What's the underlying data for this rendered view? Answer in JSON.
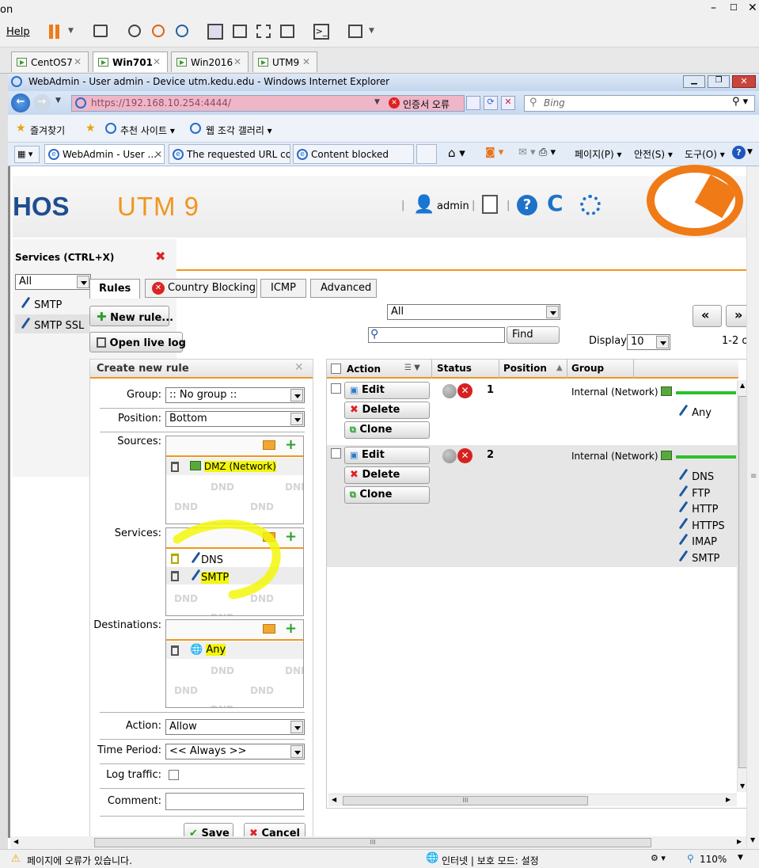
{
  "vm": {
    "title_fragment": "on",
    "menu_help": "Help",
    "tabs": [
      "CentOS7",
      "Win701",
      "Win2016",
      "UTM9"
    ]
  },
  "ie": {
    "title": "WebAdmin - User admin - Device utm.kedu.edu - Windows Internet Explorer",
    "url": "https://192.168.10.254:4444/",
    "cert_error": "인증서 오류",
    "search_placeholder": "Bing",
    "favorites": "즐겨찾기",
    "suggested_sites": "추천 사이트 ▾",
    "web_slice": "웹 조각 갤러리 ▾",
    "tabs": [
      "WebAdmin - User ...",
      "The requested URL co...",
      "Content blocked"
    ],
    "cmd_page": "페이지(P) ▾",
    "cmd_safety": "안전(S) ▾",
    "cmd_tools": "도구(O) ▾",
    "status_text": "페이지에 오류가 있습니다.",
    "zone_text": "인터넷 | 보호 모드: 설정",
    "zoom": "110%"
  },
  "header": {
    "brand_fragment": "HOS",
    "product": "UTM 9",
    "user": "admin"
  },
  "services_panel": {
    "title": "Services (CTRL+X)",
    "filter_value": "All",
    "items": [
      "SMTP",
      "SMTP SSL"
    ]
  },
  "tabs": [
    "Rules",
    "Country Blocking",
    "ICMP",
    "Advanced"
  ],
  "toolbar": {
    "new_rule": "New rule...",
    "open_live_log": "Open live log",
    "filter_value": "All",
    "find": "Find",
    "display_label": "Display:",
    "display_value": "10",
    "range": "1-2 of",
    "prev": "«",
    "next": "»"
  },
  "form": {
    "title": "Create new rule",
    "group_label": "Group:",
    "group_value": ":: No group ::",
    "position_label": "Position:",
    "position_value": "Bottom",
    "sources_label": "Sources:",
    "sources": [
      "DMZ (Network)"
    ],
    "services_label": "Services:",
    "services": [
      "DNS",
      "SMTP"
    ],
    "destinations_label": "Destinations:",
    "destinations": [
      "Any"
    ],
    "action_label": "Action:",
    "action_value": "Allow",
    "time_label": "Time Period:",
    "time_value": "<< Always >>",
    "log_label": "Log traffic:",
    "comment_label": "Comment:",
    "dnd": "DND",
    "save": "Save",
    "cancel": "Cancel"
  },
  "grid": {
    "columns": [
      "Action",
      "Status",
      "Position",
      "Group"
    ],
    "edit": "Edit",
    "delete": "Delete",
    "clone": "Clone",
    "rows": [
      {
        "position": "1",
        "source": "Internal (Network)",
        "services": [
          "Any"
        ]
      },
      {
        "position": "2",
        "source": "Internal (Network)",
        "services": [
          "DNS",
          "FTP",
          "HTTP",
          "HTTPS",
          "IMAP",
          "SMTP"
        ]
      }
    ],
    "hscroll": "III"
  },
  "colors": {
    "accent": "#f0961e",
    "highlight": "#f3f70a",
    "green": "#2cc02c",
    "brand_blue": "#1e56a0"
  }
}
